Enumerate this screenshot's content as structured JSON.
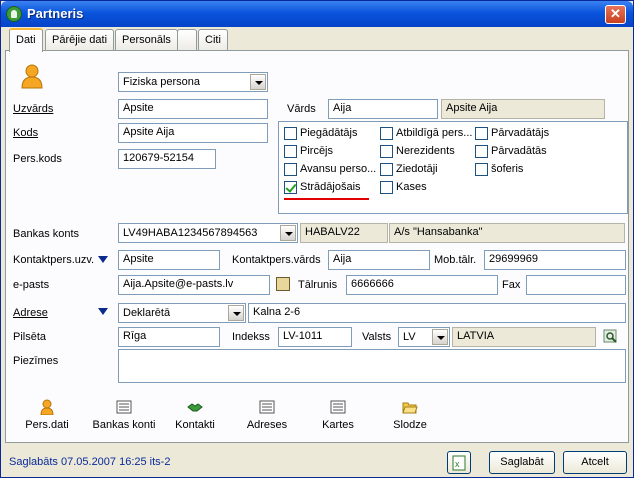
{
  "window": {
    "title": "Partneris"
  },
  "tabs": [
    {
      "label": "Dati"
    },
    {
      "label": "Pārējie dati"
    },
    {
      "label": "Personāls"
    },
    {
      "label": ""
    },
    {
      "label": "Citi"
    }
  ],
  "form": {
    "person_type": "Fiziska persona",
    "surname_label": "Uzvārds",
    "surname": "Apsite",
    "name_label": "Vārds",
    "name": "Aija",
    "full_name": "Apsite Aija",
    "code_label": "Kods",
    "code": "Apsite Aija",
    "pers_code_label": "Pers.kods",
    "pers_code": "120679-52154",
    "checkboxes": [
      {
        "label": "Piegādātājs",
        "checked": false
      },
      {
        "label": "Atbildīgā pers...",
        "checked": false
      },
      {
        "label": "Pārvadātājs",
        "checked": false
      },
      {
        "label": "Pircējs",
        "checked": false
      },
      {
        "label": "Nerezidents",
        "checked": false
      },
      {
        "label": "Pārvadātās",
        "checked": false
      },
      {
        "label": "Avansu perso...",
        "checked": false
      },
      {
        "label": "Ziedotāji",
        "checked": false
      },
      {
        "label": "šoferis",
        "checked": false
      },
      {
        "label": "Strādājošais",
        "checked": true
      },
      {
        "label": "Kases",
        "checked": false
      }
    ],
    "bank_account_label": "Bankas konts",
    "bank_account": "LV49HABA1234567894563",
    "bank_code": "HABALV22",
    "bank_name": "A/s \"Hansabanka\"",
    "contact_surname_label": "Kontaktpers.uzv.",
    "contact_surname": "Apsite",
    "contact_name_label": "Kontaktpers.vārds",
    "contact_name": "Aija",
    "mobile_label": "Mob.tālr.",
    "mobile": "29699969",
    "email_label": "e-pasts",
    "email": "Aija.Apsite@e-pasts.lv",
    "phone_label": "Tālrunis",
    "phone": "6666666",
    "fax_label": "Fax",
    "fax": "",
    "address_label": "Adrese",
    "address_type": "Deklarētā",
    "address": "Kalna 2-6",
    "city_label": "Pilsēta",
    "city": "Rīga",
    "index_label": "Indekss",
    "index": "LV-1011",
    "country_label": "Valsts",
    "country_code": "LV",
    "country_name": "LATVIA",
    "notes_label": "Piezīmes",
    "notes": ""
  },
  "toolbar": [
    {
      "label": "Pers.dati"
    },
    {
      "label": "Bankas konti"
    },
    {
      "label": "Kontakti"
    },
    {
      "label": "Adreses"
    },
    {
      "label": "Kartes"
    },
    {
      "label": "Slodze"
    }
  ],
  "status": {
    "text": "Saglabāts 07.05.2007 16:25 its-2",
    "save_label": "Saglabāt",
    "cancel_label": "Atcelt"
  },
  "colors": {
    "title_bar": "#0a55dc",
    "status_text": "#0a2a9c",
    "check_mark": "#21a121",
    "highlight_line": "#e00000"
  }
}
